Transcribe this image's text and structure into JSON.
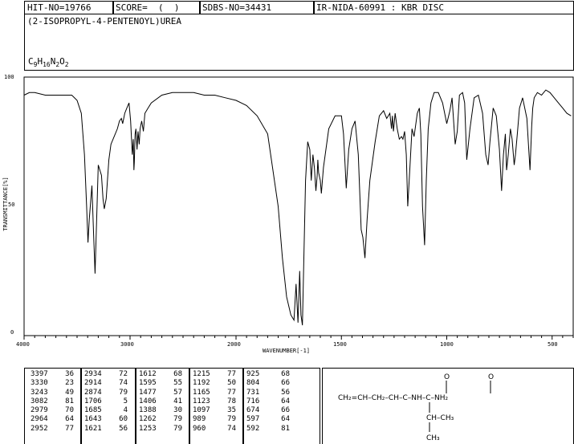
{
  "header": {
    "hit_no": "HIT-NO=19766",
    "score": "SCORE=  (  )",
    "sdbs_no": "SDBS-NO=34431",
    "ir_info": "IR-NIDA-60991 : KBR DISC"
  },
  "compound": {
    "name": "(2-ISOPROPYL-4-PENTENOYL)UREA",
    "formula_parts": [
      "C",
      "9",
      "H",
      "16",
      "N",
      "2",
      "O",
      "2"
    ]
  },
  "chart_data": {
    "type": "line",
    "xlabel": "WAVENUMBER[-1]",
    "ylabel": "TRANSMITTANCE[%]",
    "xlim": [
      4000,
      400
    ],
    "ylim": [
      0,
      100
    ],
    "x_ticks": [
      4000,
      3000,
      2000,
      1500,
      1000,
      500
    ],
    "y_ticks": [
      0,
      50,
      100
    ],
    "x": [
      4000,
      3950,
      3900,
      3800,
      3700,
      3600,
      3550,
      3500,
      3460,
      3430,
      3410,
      3397,
      3385,
      3360,
      3345,
      3330,
      3315,
      3300,
      3270,
      3255,
      3243,
      3225,
      3200,
      3180,
      3150,
      3120,
      3100,
      3082,
      3070,
      3050,
      3030,
      3010,
      2995,
      2979,
      2970,
      2964,
      2960,
      2952,
      2945,
      2934,
      2925,
      2914,
      2905,
      2890,
      2874,
      2860,
      2830,
      2800,
      2700,
      2600,
      2500,
      2400,
      2300,
      2200,
      2100,
      2000,
      1950,
      1900,
      1850,
      1800,
      1780,
      1760,
      1740,
      1725,
      1715,
      1706,
      1698,
      1692,
      1685,
      1678,
      1670,
      1660,
      1650,
      1643,
      1635,
      1628,
      1621,
      1615,
      1612,
      1608,
      1600,
      1595,
      1585,
      1560,
      1530,
      1500,
      1490,
      1477,
      1465,
      1450,
      1435,
      1420,
      1406,
      1398,
      1388,
      1378,
      1365,
      1340,
      1320,
      1300,
      1285,
      1270,
      1262,
      1258,
      1253,
      1245,
      1235,
      1225,
      1215,
      1208,
      1200,
      1192,
      1185,
      1175,
      1165,
      1155,
      1140,
      1130,
      1123,
      1115,
      1105,
      1097,
      1088,
      1075,
      1060,
      1040,
      1020,
      1000,
      985,
      975,
      960,
      950,
      940,
      925,
      915,
      905,
      890,
      870,
      850,
      830,
      815,
      804,
      795,
      780,
      765,
      750,
      740,
      731,
      722,
      716,
      708,
      698,
      690,
      680,
      674,
      665,
      655,
      640,
      620,
      605,
      597,
      592,
      585,
      570,
      550,
      530,
      510,
      490,
      470,
      450,
      430,
      410,
      400
    ],
    "y": [
      93,
      94,
      94,
      93,
      93,
      93,
      93,
      91,
      86,
      70,
      50,
      36,
      45,
      58,
      40,
      24,
      45,
      66,
      62,
      53,
      49,
      53,
      68,
      74,
      77,
      80,
      83,
      84,
      82,
      86,
      88,
      90,
      83,
      70,
      76,
      64,
      67,
      78,
      80,
      72,
      79,
      74,
      80,
      83,
      79,
      86,
      88,
      90,
      93,
      94,
      94,
      94,
      93,
      93,
      92,
      91,
      89,
      85,
      78,
      50,
      30,
      15,
      8,
      6,
      20,
      5,
      25,
      8,
      4,
      30,
      60,
      75,
      72,
      60,
      70,
      65,
      56,
      62,
      68,
      63,
      60,
      55,
      65,
      80,
      85,
      85,
      78,
      57,
      72,
      80,
      83,
      70,
      41,
      38,
      30,
      45,
      60,
      75,
      85,
      87,
      84,
      86,
      80,
      85,
      79,
      86,
      80,
      76,
      77,
      76,
      79,
      70,
      50,
      65,
      80,
      77,
      86,
      88,
      78,
      50,
      35,
      60,
      80,
      90,
      94,
      94,
      90,
      82,
      87,
      92,
      74,
      79,
      93,
      94,
      90,
      68,
      80,
      92,
      93,
      86,
      70,
      66,
      75,
      88,
      85,
      72,
      56,
      70,
      78,
      64,
      70,
      80,
      76,
      66,
      70,
      78,
      88,
      92,
      84,
      64,
      81,
      88,
      92,
      94,
      93,
      95,
      94,
      92,
      90,
      88,
      86,
      85
    ]
  },
  "peak_table": {
    "columns": [
      {
        "wn": [
          "3397",
          "3330",
          "3243",
          "3082",
          "2979",
          "2964",
          "2952"
        ],
        "t": [
          "36",
          "23",
          "49",
          "81",
          "70",
          "64",
          "77"
        ]
      },
      {
        "wn": [
          "2934",
          "2914",
          "2874",
          "1706",
          "1685",
          "1643",
          "1621"
        ],
        "t": [
          "72",
          "74",
          "79",
          "5",
          "4",
          "60",
          "56"
        ]
      },
      {
        "wn": [
          "1612",
          "1595",
          "1477",
          "1406",
          "1388",
          "1262",
          "1253"
        ],
        "t": [
          "68",
          "55",
          "57",
          "41",
          "30",
          "79",
          "79"
        ]
      },
      {
        "wn": [
          "1215",
          "1192",
          "1165",
          "1123",
          "1097",
          "989",
          "960"
        ],
        "t": [
          "77",
          "50",
          "77",
          "78",
          "35",
          "79",
          "74"
        ]
      },
      {
        "wn": [
          "925",
          "804",
          "731",
          "716",
          "674",
          "597",
          "592"
        ],
        "t": [
          "68",
          "66",
          "56",
          "64",
          "66",
          "64",
          "81"
        ]
      }
    ]
  },
  "structure": {
    "main_chain": "CH₂=CH–CH₂–CH–C–NH–C–NH₂",
    "o1": "O",
    "o2": "O",
    "branch_ch": "CH–CH₃",
    "branch_ch3": "CH₃"
  }
}
